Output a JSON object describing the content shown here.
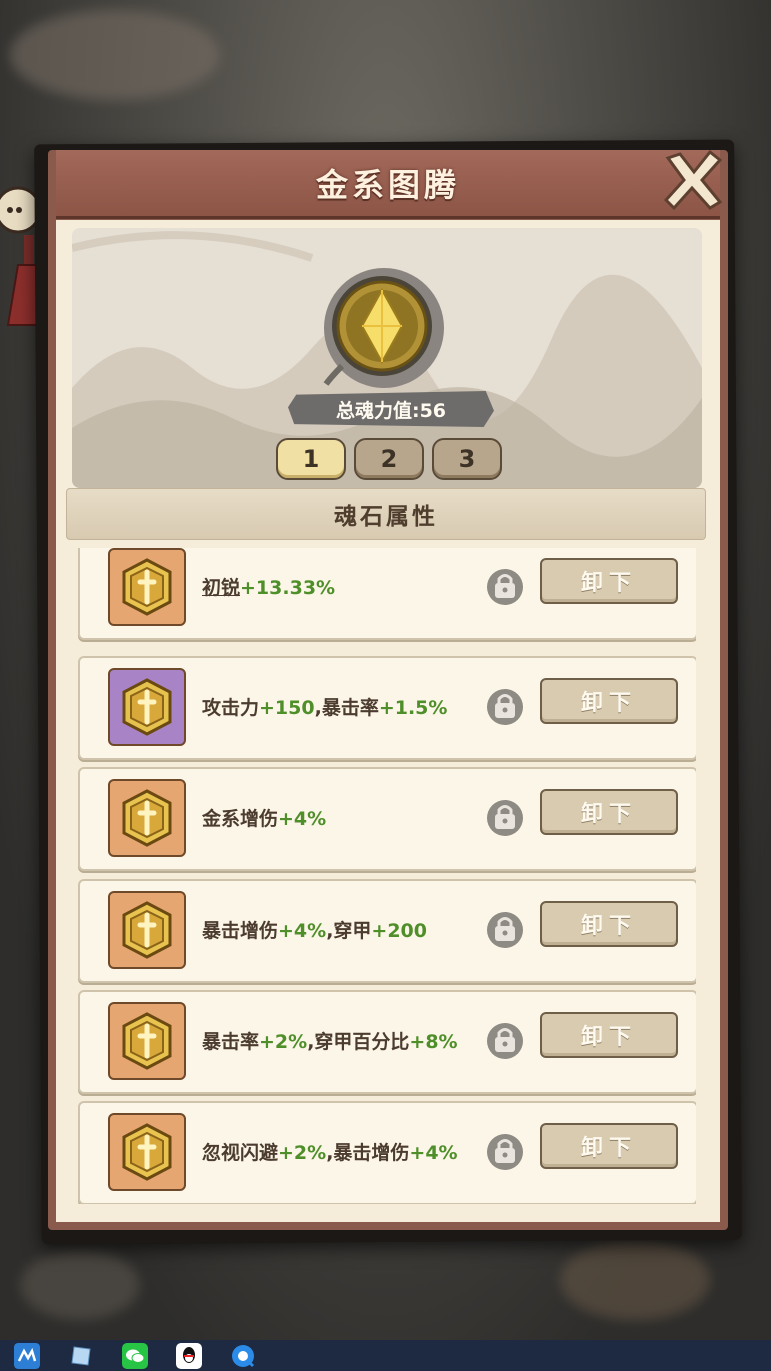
{
  "panel": {
    "title": "金系图腾"
  },
  "emblem": {
    "power_label": "总魂力值:56"
  },
  "tabs": [
    {
      "label": "1",
      "active": true
    },
    {
      "label": "2",
      "active": false
    },
    {
      "label": "3",
      "active": false
    }
  ],
  "section": {
    "title": "魂石属性"
  },
  "rows": [
    {
      "parts": [
        {
          "t": "初锐",
          "style": "ul"
        },
        {
          "t": "+13.33%",
          "style": "g"
        }
      ],
      "stone": "gold",
      "button": "卸下"
    },
    {
      "parts": [
        {
          "t": "攻击力",
          "style": ""
        },
        {
          "t": "+150",
          "style": "g"
        },
        {
          "t": ",暴击率",
          "style": ""
        },
        {
          "t": "+1.5%",
          "style": "g"
        }
      ],
      "stone": "purple",
      "button": "卸下"
    },
    {
      "parts": [
        {
          "t": "金系增伤",
          "style": ""
        },
        {
          "t": "+4%",
          "style": "g"
        }
      ],
      "stone": "gold",
      "button": "卸下"
    },
    {
      "parts": [
        {
          "t": "暴击增伤",
          "style": ""
        },
        {
          "t": "+4%",
          "style": "g"
        },
        {
          "t": ",穿甲",
          "style": ""
        },
        {
          "t": "+200",
          "style": "g"
        }
      ],
      "stone": "gold",
      "button": "卸下"
    },
    {
      "parts": [
        {
          "t": "暴击率",
          "style": ""
        },
        {
          "t": "+2%",
          "style": "g"
        },
        {
          "t": ",穿甲百分比",
          "style": ""
        },
        {
          "t": "+8%",
          "style": "g"
        }
      ],
      "stone": "gold",
      "button": "卸下"
    },
    {
      "parts": [
        {
          "t": "忽视闪避",
          "style": ""
        },
        {
          "t": "+2%",
          "style": "g"
        },
        {
          "t": ",暴击增伤",
          "style": ""
        },
        {
          "t": "+4%",
          "style": "g"
        }
      ],
      "stone": "gold",
      "button": "卸下"
    }
  ],
  "colors": {
    "green_value": "#4f8f2a",
    "title_bar": "#a3695a",
    "panel_border": "#1b1815"
  },
  "taskbar": {
    "icons": [
      "app-icon",
      "notes-icon",
      "wechat-icon",
      "qq-icon",
      "browser-icon"
    ]
  }
}
